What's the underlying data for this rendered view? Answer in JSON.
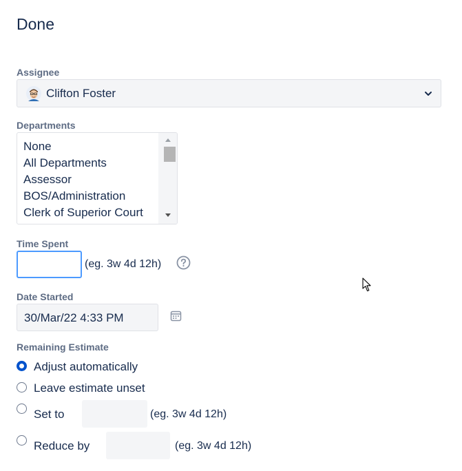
{
  "header": {
    "title": "Done"
  },
  "assignee": {
    "label": "Assignee",
    "selected": "Clifton Foster"
  },
  "departments": {
    "label": "Departments",
    "options": [
      "None",
      "All Departments",
      "Assessor",
      "BOS/Administration",
      "Clerk of Superior Court"
    ]
  },
  "time_spent": {
    "label": "Time Spent",
    "value": "",
    "hint": "(eg. 3w 4d 12h)"
  },
  "date_started": {
    "label": "Date Started",
    "value": "30/Mar/22 4:33 PM"
  },
  "remaining_estimate": {
    "label": "Remaining Estimate",
    "options": {
      "adjust": "Adjust automatically",
      "leave": "Leave estimate unset",
      "set_to": "Set to",
      "reduce_by": "Reduce by"
    },
    "selected": "adjust",
    "set_to_hint": "(eg. 3w 4d 12h)",
    "reduce_by_hint": "(eg. 3w 4d 12h)"
  },
  "colors": {
    "accent": "#0052cc",
    "focus": "#4c9aff",
    "label": "#5e6c84",
    "text": "#172b4d"
  }
}
